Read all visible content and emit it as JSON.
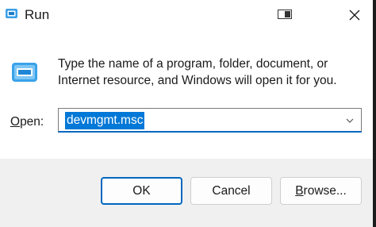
{
  "window": {
    "title": "Run",
    "accent_color": "#0078d7"
  },
  "titlebar": {
    "app_icon": "run-icon",
    "snap_icon": "snap-layout-icon",
    "close_icon": "close-icon"
  },
  "dialog": {
    "description": "Type the name of a program, folder, document, or Internet resource, and Windows will open it for you.",
    "open_label_prefix": "O",
    "open_label_rest": "pen:",
    "open_value": "devmgmt.msc",
    "dropdown_icon": "chevron-down-icon"
  },
  "buttons": {
    "ok": "OK",
    "cancel": "Cancel",
    "browse_prefix": "B",
    "browse_rest": "rowse..."
  }
}
